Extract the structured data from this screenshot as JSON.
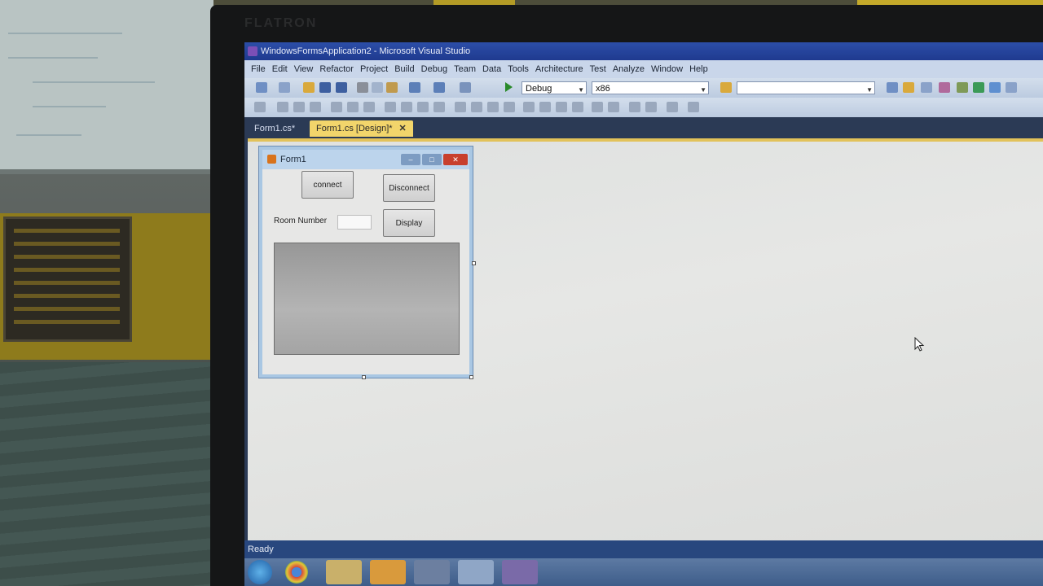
{
  "monitor": {
    "brand": "FLATRON"
  },
  "window": {
    "title": "WindowsFormsApplication2 - Microsoft Visual Studio"
  },
  "menu": [
    "File",
    "Edit",
    "View",
    "Refactor",
    "Project",
    "Build",
    "Debug",
    "Team",
    "Data",
    "Tools",
    "Architecture",
    "Test",
    "Analyze",
    "Window",
    "Help"
  ],
  "toolbar": {
    "config": "Debug",
    "platform": "x86"
  },
  "tabs": {
    "inactive": "Form1.cs*",
    "active": "Form1.cs [Design]*",
    "close": "✕"
  },
  "form": {
    "title": "Form1",
    "connect_label": "connect",
    "disconnect_label": "Disconnect",
    "room_label": "Room Number",
    "display_label": "Display"
  },
  "status": {
    "text": "Ready"
  },
  "colors": {
    "accent_tab": "#f2d56b",
    "titlebar": "#2c4ea8",
    "statusbar": "#28477e"
  }
}
